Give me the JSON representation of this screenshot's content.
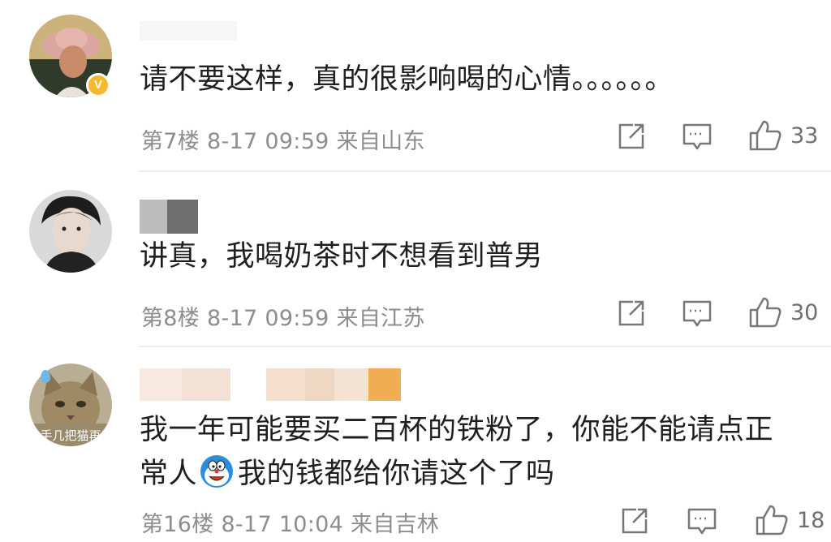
{
  "comments": [
    {
      "text": "请不要这样，真的很影响喝的心情。。。。。。",
      "floor": "第7楼",
      "date": "8-17",
      "time": "09:59",
      "location": "来自山东",
      "likes": "33",
      "verified_badge": "V"
    },
    {
      "text": "讲真，我喝奶茶时不想看到普男",
      "floor": "第8楼",
      "date": "8-17",
      "time": "09:59",
      "location": "来自江苏",
      "likes": "30"
    },
    {
      "text_line1": "我一年可能要买二百杯的铁粉了，你能不能请点正",
      "text_line2_before": "常人",
      "text_line2_after": "我的钱都给你请这个了吗",
      "floor": "第16楼",
      "date": "8-17",
      "time": "10:04",
      "location": "来自吉林",
      "likes": "18",
      "avatar_caption": "手几把猫再"
    }
  ],
  "icons": {
    "share": "share-icon",
    "reply": "comment-icon",
    "like": "thumbs-up-icon",
    "emoji": "doraemon-emoji-icon"
  },
  "colors": {
    "text": "#1f1f1f",
    "meta": "#8d8d8d",
    "divider": "#eeeeee",
    "verified": "#f5b82e"
  }
}
